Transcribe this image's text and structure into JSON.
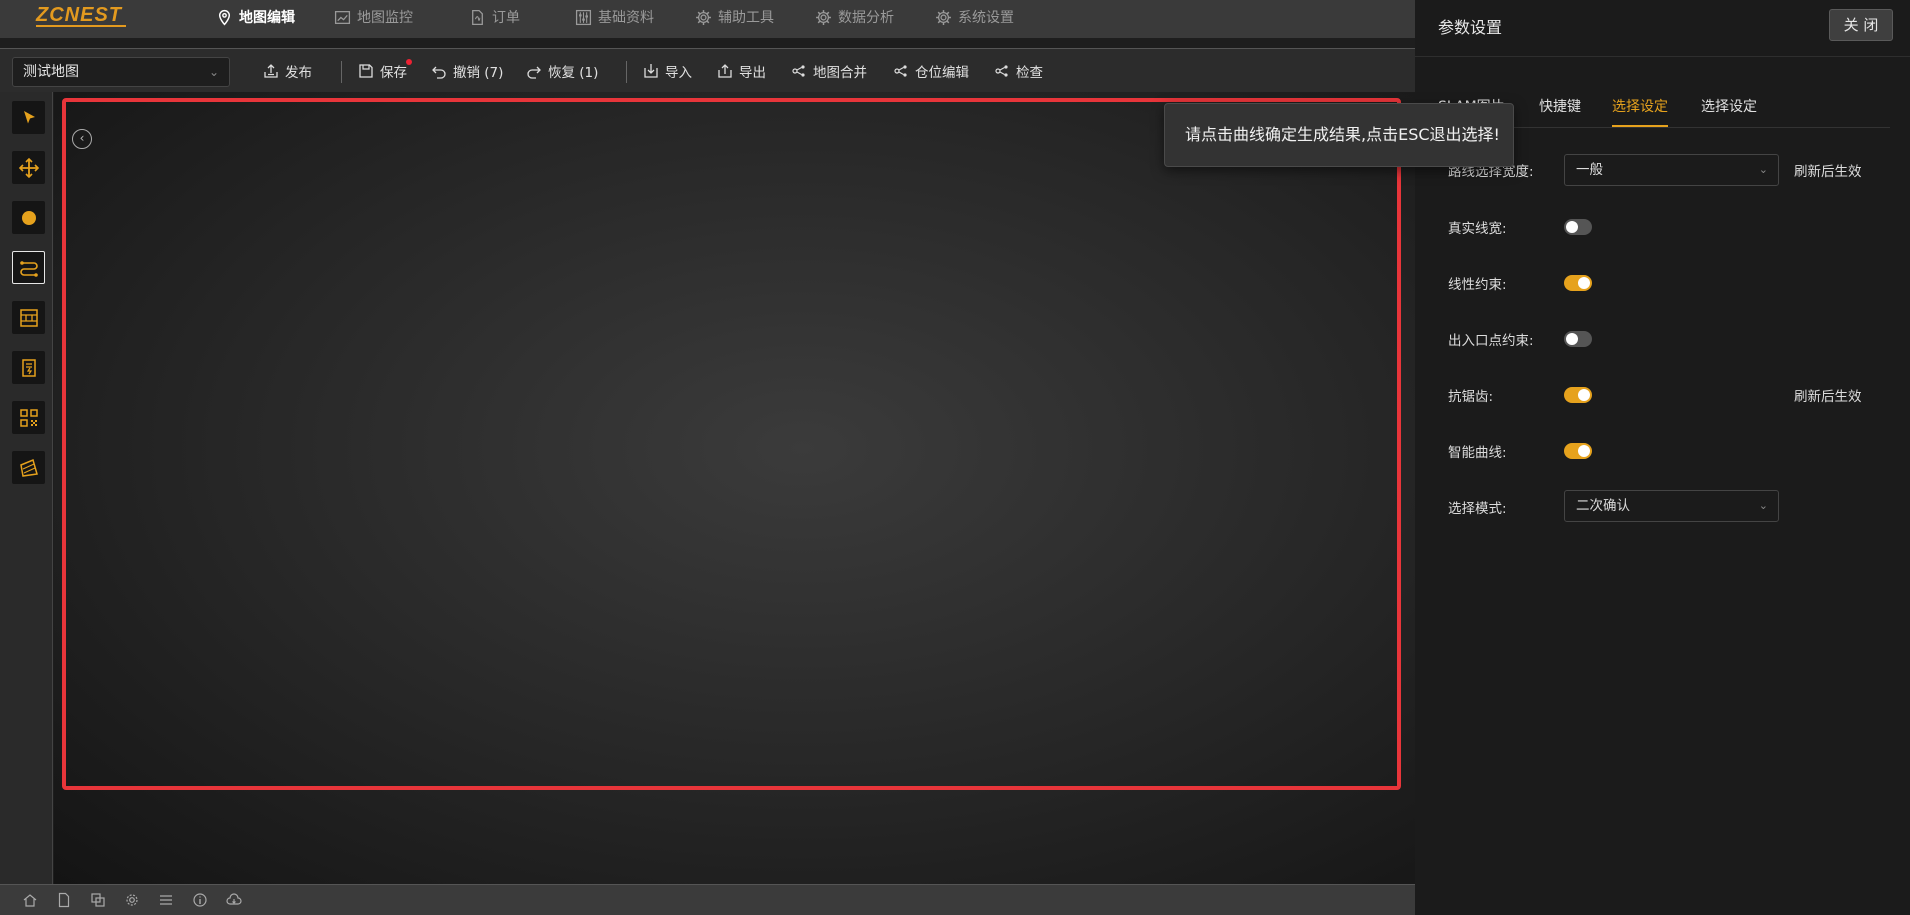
{
  "nav": {
    "logo": "ZCNEST",
    "items": [
      "地图编辑",
      "地图监控",
      "订单",
      "基础资料",
      "辅助工具",
      "数据分析",
      "系统设置"
    ]
  },
  "toolbar": {
    "map_select": "测试地图",
    "publish": "发布",
    "save": "保存",
    "undo": "撤销 (7)",
    "redo": "恢复 (1)",
    "import": "导入",
    "export": "导出",
    "merge": "地图合并",
    "location_edit": "仓位编辑",
    "check": "检查"
  },
  "tooltip": "请点击曲线确定生成结果,点击ESC退出选择!",
  "panel": {
    "title": "参数设置",
    "close": "关 闭",
    "tabs": [
      "SLAM图片",
      "快捷键",
      "选择设定",
      "选择设定"
    ],
    "active_tab": 2,
    "rows": {
      "path_width": {
        "label": "路线选择宽度:",
        "value": "一般",
        "note": "刷新后生效"
      },
      "real_width": {
        "label": "真实线宽:",
        "on": false
      },
      "linear_constraint": {
        "label": "线性约束:",
        "on": true
      },
      "io_point_constraint": {
        "label": "出入口点约束:",
        "on": false
      },
      "antialias": {
        "label": "抗锯齿:",
        "on": true,
        "note": "刷新后生效"
      },
      "smart_curve": {
        "label": "智能曲线:",
        "on": true
      },
      "select_mode": {
        "label": "选择模式:",
        "value": "二次确认"
      }
    }
  },
  "colors": {
    "accent": "#e6a21d",
    "selection": "#e8353a",
    "panel_bg": "#1b1b1b"
  }
}
